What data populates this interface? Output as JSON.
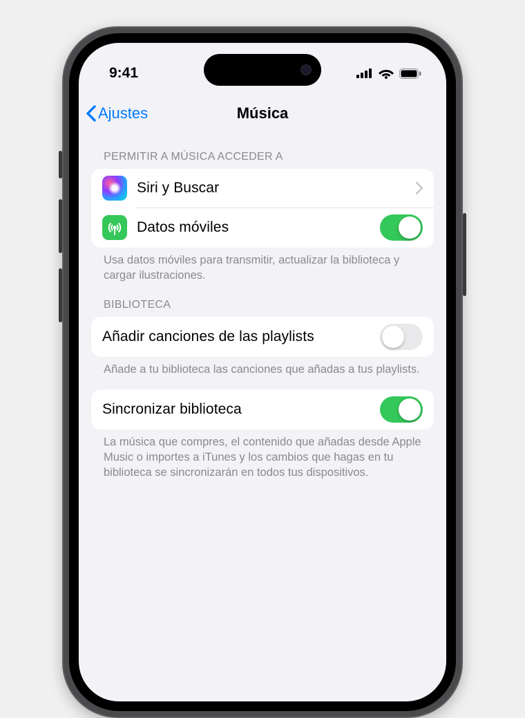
{
  "status": {
    "time": "9:41"
  },
  "nav": {
    "back": "Ajustes",
    "title": "Música"
  },
  "sections": {
    "access": {
      "header": "PERMITIR A MÚSICA ACCEDER A",
      "siri_label": "Siri y Buscar",
      "cellular_label": "Datos móviles",
      "cellular_on": true,
      "footer": "Usa datos móviles para transmitir, actualizar la biblioteca y cargar ilustraciones."
    },
    "library": {
      "header": "BIBLIOTECA",
      "add_label": "Añadir canciones de las playlists",
      "add_on": false,
      "add_footer": "Añade a tu biblioteca las canciones que añadas a tus playlists.",
      "sync_label": "Sincronizar biblioteca",
      "sync_on": true,
      "sync_footer": "La música que compres, el contenido que añadas desde Apple Music o importes a iTunes y los cambios que hagas en tu biblioteca se sincronizarán en todos tus dispositivos."
    }
  },
  "colors": {
    "accent": "#007aff",
    "toggle_on": "#34c759",
    "bg": "#f2f2f7"
  }
}
